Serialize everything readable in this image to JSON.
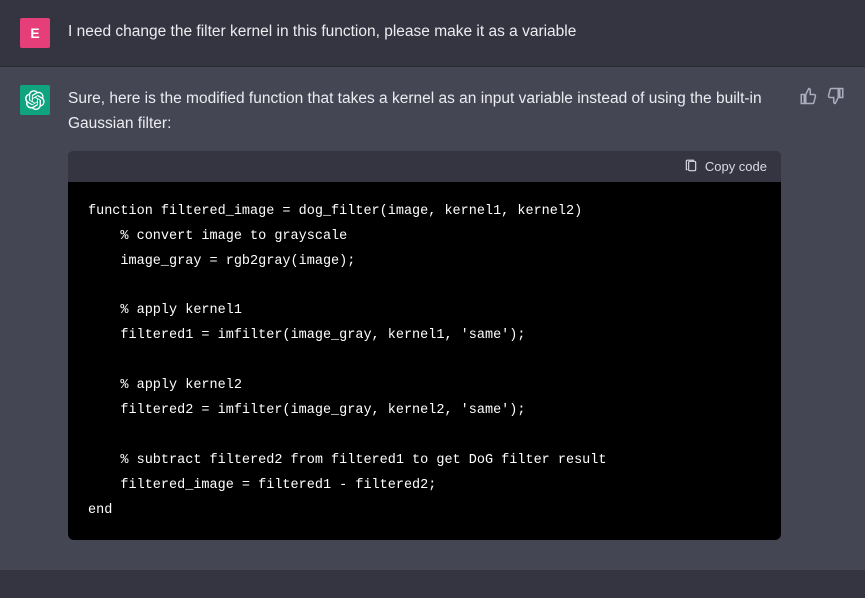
{
  "user": {
    "initial": "E",
    "prompt": "I need change the filter kernel in this function, please make it as a variable"
  },
  "assistant": {
    "reply": "Sure, here is the modified function that takes a kernel as an input variable instead of using the built-in Gaussian filter:",
    "copy_label": "Copy code",
    "code": "function filtered_image = dog_filter(image, kernel1, kernel2)\n    % convert image to grayscale\n    image_gray = rgb2gray(image);\n\n    % apply kernel1\n    filtered1 = imfilter(image_gray, kernel1, 'same');\n\n    % apply kernel2\n    filtered2 = imfilter(image_gray, kernel2, 'same');\n\n    % subtract filtered2 from filtered1 to get DoG filter result\n    filtered_image = filtered1 - filtered2;\nend"
  }
}
